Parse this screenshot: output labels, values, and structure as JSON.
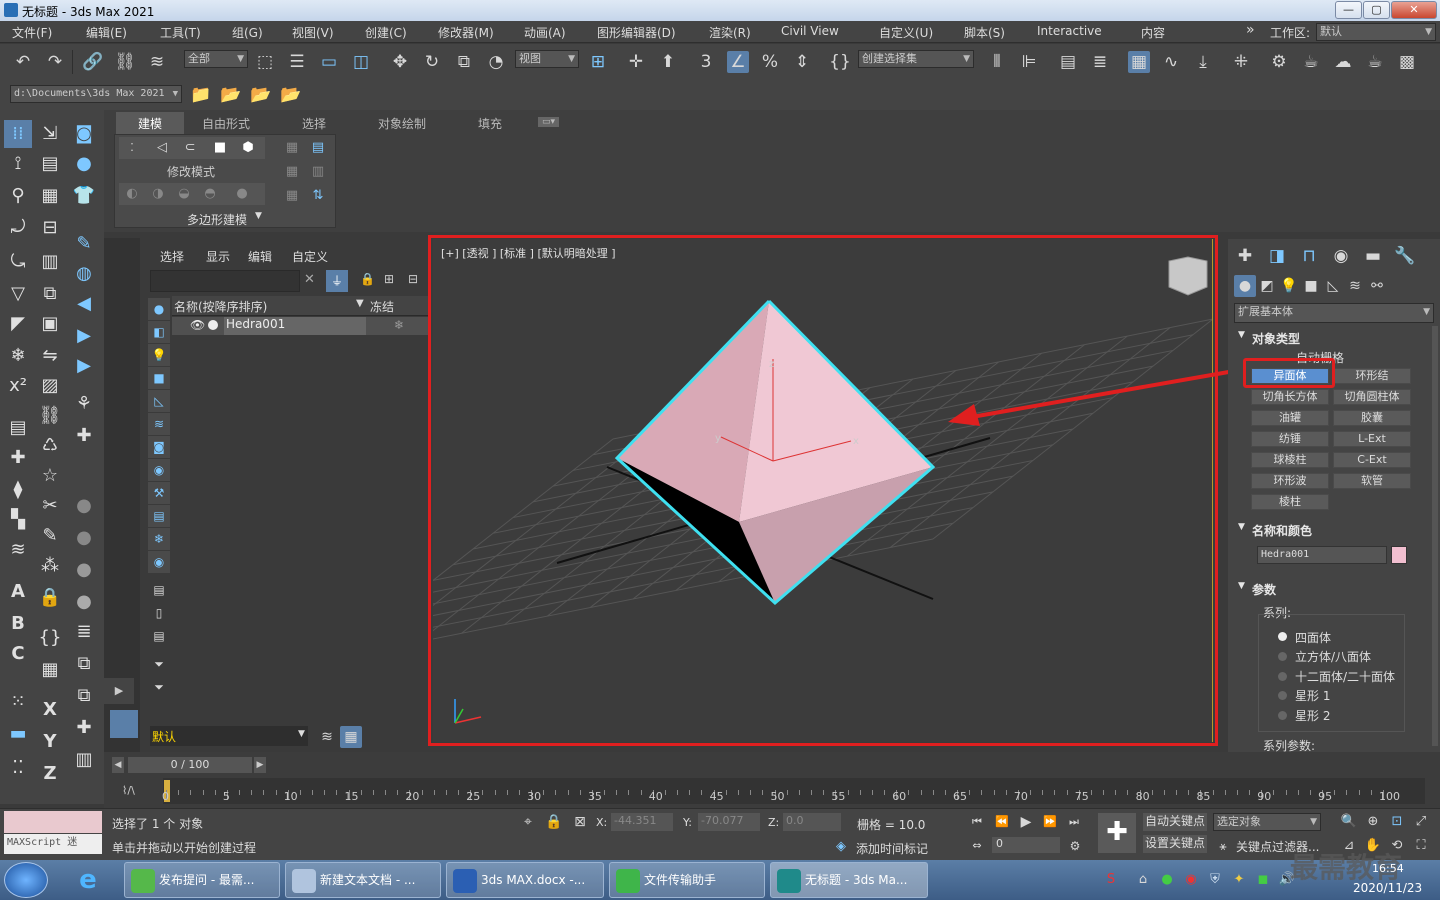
{
  "window": {
    "title": "无标题 - 3ds Max 2021",
    "min_glyph": "—",
    "max_glyph": "▢",
    "close_glyph": "✕"
  },
  "menu": {
    "items": [
      "文件(F)",
      "编辑(E)",
      "工具(T)",
      "组(G)",
      "视图(V)",
      "创建(C)",
      "修改器(M)",
      "动画(A)",
      "图形编辑器(D)",
      "渲染(R)",
      "Civil View",
      "自定义(U)",
      "脚本(S)",
      "Interactive",
      "内容"
    ],
    "overflow": "»",
    "workspace_label": "工作区:",
    "workspace_value": "默认"
  },
  "toolbar": {
    "selection_filter": "全部",
    "ref_coord": "视图",
    "named_selection": "创建选择集"
  },
  "project_path": "d:\\Documents\\3ds Max 2021",
  "ribbon": {
    "tabs": [
      "建模",
      "自由形式",
      "选择",
      "对象绘制",
      "填充"
    ],
    "active_tab": "建模",
    "group_modify_mode": "修改模式",
    "group_poly": "多边形建模"
  },
  "scene_explorer": {
    "menu": [
      "选择",
      "显示",
      "编辑",
      "自定义"
    ],
    "col_name": "名称(按降序排序)",
    "col_freeze": "冻结",
    "object": "Hedra001",
    "layer_label": "默认"
  },
  "viewport": {
    "label": "[+] [透视 ] [标准 ] [默认明暗处理 ]",
    "object_color": "#f0c8d4",
    "selection_color": "#3fe0f0",
    "axis_x": "x",
    "axis_y": "y",
    "axis_z": "z"
  },
  "command_panel": {
    "category": "扩展基本体",
    "rollout_object_type": "对象类型",
    "autogrid": "自动栅格",
    "buttons": [
      "异面体",
      "环形结",
      "切角长方体",
      "切角圆柱体",
      "油罐",
      "胶囊",
      "纺锤",
      "L-Ext",
      "球棱柱",
      "C-Ext",
      "环形波",
      "软管",
      "棱柱"
    ],
    "selected_button": "异面体",
    "rollout_name_color": "名称和颜色",
    "object_name": "Hedra001",
    "object_color": "#f2bfd0",
    "rollout_params": "参数",
    "family_label": "系列:",
    "family_options": [
      "四面体",
      "立方体/八面体",
      "十二面体/二十面体",
      "星形 1",
      "星形 2"
    ],
    "family_selected": 0,
    "family_params_label": "系列参数:"
  },
  "timeline": {
    "frame_display": "0 / 100",
    "ticks": [
      "0",
      "5",
      "10",
      "15",
      "20",
      "25",
      "30",
      "35",
      "40",
      "45",
      "50",
      "55",
      "60",
      "65",
      "70",
      "75",
      "80",
      "85",
      "90",
      "95",
      "100"
    ]
  },
  "status": {
    "maxscript": "MAXScript 迷",
    "selection": "选择了 1 个 对象",
    "prompt": "单击并拖动以开始创建过程",
    "x_label": "X:",
    "x_value": "-44.351",
    "y_label": "Y:",
    "y_value": "-70.077",
    "z_label": "Z:",
    "z_value": "0.0",
    "grid": "栅格 = 10.0",
    "add_time_tag": "添加时间标记",
    "auto_key": "自动关键点",
    "set_key": "设置关键点",
    "selected_object": "选定对象",
    "key_filters": "关键点过滤器...",
    "current_frame": "0"
  },
  "taskbar": {
    "items": [
      "发布提问 - 最需...",
      "新建文本文档 - ...",
      "3ds MAX.docx -...",
      "文件传输助手",
      "无标题 - 3ds Ma..."
    ],
    "clock_time": "16:54",
    "clock_date": "2020/11/23",
    "watermark": "最需教育"
  }
}
